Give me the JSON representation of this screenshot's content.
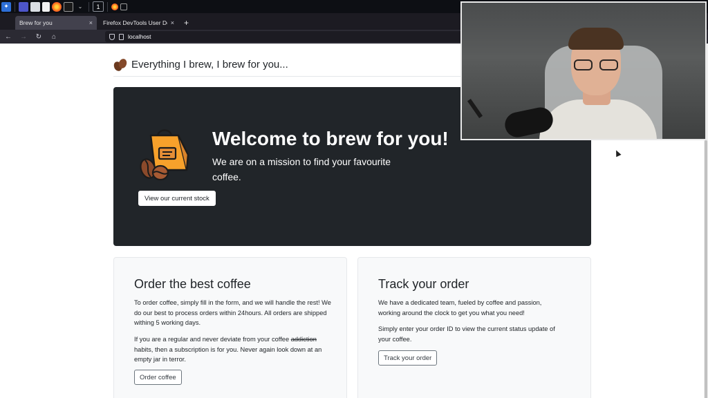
{
  "taskbar": {
    "workspace_number": "1",
    "icons": [
      "app-launcher-icon",
      "desktop-icon",
      "files-icon",
      "document-icon",
      "firefox-icon",
      "terminal-icon",
      "chevron-down-icon",
      "firefox-window-icon",
      "screen-icon"
    ]
  },
  "browser": {
    "tabs": [
      {
        "label": "Brew for you",
        "active": true
      },
      {
        "label": "Firefox DevTools User Do",
        "active": false
      }
    ],
    "new_tab": "+",
    "url": "localhost"
  },
  "page": {
    "site_title": "Everything I brew, I brew for you...",
    "hero": {
      "heading": "Welcome to brew for you!",
      "text": "We are on a mission to find your favourite coffee.",
      "button": "View our current stock"
    },
    "order_card": {
      "title": "Order the best coffee",
      "p1": "To order coffee, simply fill in the form, and we will handle the rest! We do our best to process orders within 24hours. All orders are shipped withing 5 working days.",
      "p2_before": "If you are a regular and never deviate from your coffee ",
      "p2_strike": "addiction",
      "p2_after": " habits, then a subscription is for you. Never again look down at an empty jar in terror.",
      "button": "Order coffee"
    },
    "track_card": {
      "title": "Track your order",
      "p1": "We have a dedicated team, fueled by coffee and passion, working around the clock to get you what you need!",
      "p2": "Simply enter your order ID to view the current status update of your coffee.",
      "button": "Track your order"
    }
  },
  "colors": {
    "hero_bg": "#212529",
    "card_bg": "#f8f9fa",
    "bag_orange": "#f7a12b",
    "bean_brown": "#6b3a1f"
  }
}
